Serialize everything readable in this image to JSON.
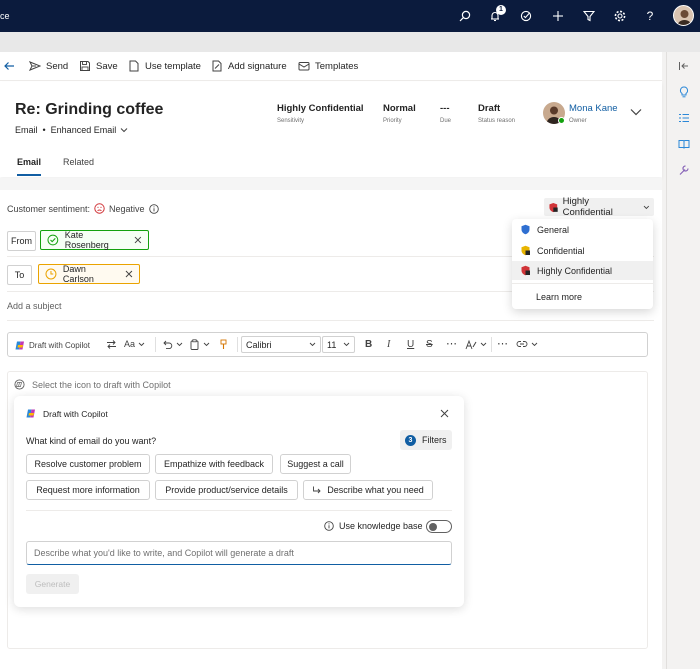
{
  "topbar": {
    "brand_fragment": "ce",
    "notification_count": "1",
    "icons": [
      "search-icon",
      "bell-icon",
      "task-icon",
      "plus-icon",
      "filter-icon",
      "gear-icon",
      "help-icon"
    ]
  },
  "toolbar": {
    "send": "Send",
    "save": "Save",
    "use_template": "Use template",
    "add_signature": "Add signature",
    "templates": "Templates"
  },
  "record": {
    "title": "Re: Grinding coffee",
    "entity": "Email",
    "form": "Enhanced Email",
    "fields": [
      {
        "value": "Highly Confidential",
        "label": "Sensitivity"
      },
      {
        "value": "Normal",
        "label": "Priority"
      },
      {
        "value": "---",
        "label": "Due"
      },
      {
        "value": "Draft",
        "label": "Status reason"
      }
    ],
    "owner_name": "Mona Kane",
    "owner_label": "Owner"
  },
  "tabs": [
    "Email",
    "Related"
  ],
  "email": {
    "sentiment_label": "Customer sentiment:",
    "sentiment_value": "Negative",
    "from_label": "From",
    "from_name": "Kate Rosenberg",
    "to_label": "To",
    "to_name": "Dawn Carlson",
    "subject_placeholder": "Add a subject"
  },
  "format_bar": {
    "draft_with_copilot": "Draft with Copilot",
    "font": "Calibri",
    "size": "11",
    "bold": "B",
    "italic": "I",
    "underline": "U",
    "strike": "S"
  },
  "editor": {
    "hint": "Select the icon to draft with Copilot"
  },
  "copilot": {
    "title": "Draft with Copilot",
    "question": "What kind of email do you want?",
    "filters_count": "3",
    "filters_label": "Filters",
    "chips_row1": [
      "Resolve customer problem",
      "Empathize with feedback",
      "Suggest a call"
    ],
    "chips_row2": [
      "Request more information",
      "Provide product/service details",
      "Describe what you need"
    ],
    "knowledge_label": "Use knowledge base",
    "prompt_placeholder": "Describe what you'd like to write, and Copilot will generate a draft",
    "generate": "Generate"
  },
  "sensitivity": {
    "current": "Highly Confidential",
    "options": [
      {
        "label": "General",
        "color": "#2f6fd1"
      },
      {
        "label": "Confidential",
        "color": "#e8b400"
      },
      {
        "label": "Highly Confidential",
        "color": "#d13438"
      }
    ],
    "learn_more": "Learn more"
  },
  "colors": {
    "topbar": "#0b1b3d",
    "accent": "#115ea3",
    "from_border": "#13a10e",
    "to_border": "#eaa300"
  }
}
